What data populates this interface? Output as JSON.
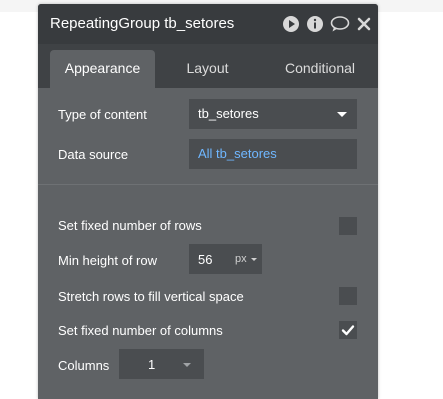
{
  "window": {
    "title": "RepeatingGroup tb_setores",
    "icons": [
      "play-icon",
      "info-icon",
      "comment-icon",
      "close-icon"
    ]
  },
  "tabs": [
    {
      "label": "Appearance",
      "active": true
    },
    {
      "label": "Layout",
      "active": false
    },
    {
      "label": "Conditional",
      "active": false
    }
  ],
  "appearance": {
    "type_of_content": {
      "label": "Type of content",
      "value": "tb_setores"
    },
    "data_source": {
      "label": "Data source",
      "value": "All tb_setores"
    },
    "fixed_rows": {
      "label": "Set fixed number of rows",
      "checked": false
    },
    "min_height": {
      "label": "Min height of row",
      "value": "56",
      "unit": "px"
    },
    "stretch_rows": {
      "label": "Stretch rows to fill vertical space",
      "checked": false
    },
    "fixed_columns": {
      "label": "Set fixed number of columns",
      "checked": true
    },
    "columns": {
      "label": "Columns",
      "value": "1"
    }
  },
  "colors": {
    "panel_bg": "#5f6265",
    "titlebar_bg": "#383b3e",
    "field_bg": "#4a4d50",
    "link_blue": "#6fb7ff"
  }
}
